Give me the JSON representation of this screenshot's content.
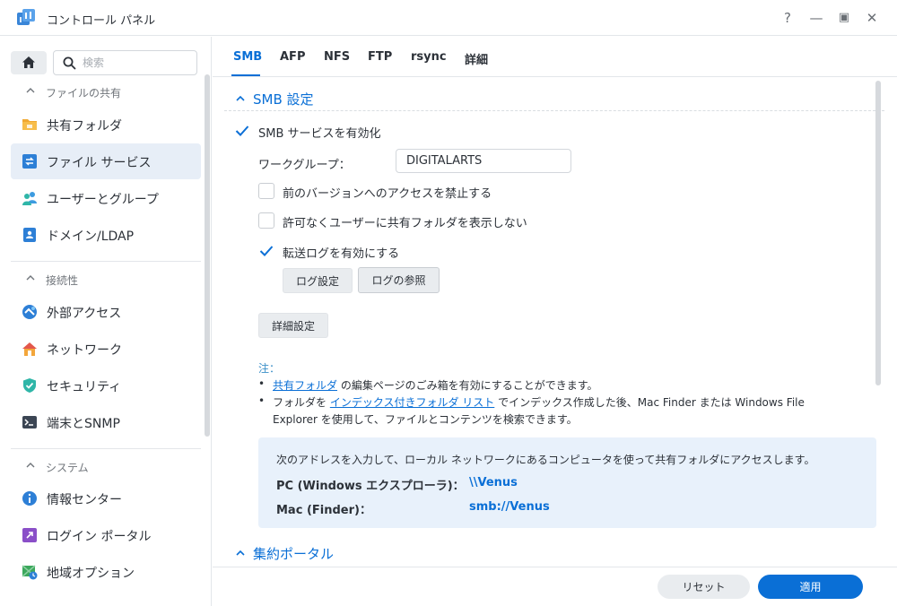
{
  "window": {
    "title": "コントロール パネル",
    "help_label": "?",
    "minimize_label": "—",
    "maximize_label": "▣",
    "close_label": "✕"
  },
  "sidebar": {
    "search_placeholder": "検索",
    "groups": [
      {
        "label": "ファイルの共有",
        "items": [
          {
            "label": "共有フォルダ",
            "icon": "folder-icon"
          },
          {
            "label": "ファイル サービス",
            "icon": "file-services-icon",
            "active": true
          },
          {
            "label": "ユーザーとグループ",
            "icon": "users-icon"
          },
          {
            "label": "ドメイン/LDAP",
            "icon": "domain-icon"
          }
        ]
      },
      {
        "label": "接続性",
        "items": [
          {
            "label": "外部アクセス",
            "icon": "external-access-icon"
          },
          {
            "label": "ネットワーク",
            "icon": "network-icon"
          },
          {
            "label": "セキュリティ",
            "icon": "security-shield-icon"
          },
          {
            "label": "端末とSNMP",
            "icon": "terminal-icon"
          }
        ]
      },
      {
        "label": "システム",
        "items": [
          {
            "label": "情報センター",
            "icon": "info-icon"
          },
          {
            "label": "ログイン ポータル",
            "icon": "login-portal-icon"
          },
          {
            "label": "地域オプション",
            "icon": "regional-options-icon"
          }
        ]
      }
    ]
  },
  "tabs": [
    {
      "label": "SMB",
      "active": true
    },
    {
      "label": "AFP"
    },
    {
      "label": "NFS"
    },
    {
      "label": "FTP"
    },
    {
      "label": "rsync"
    },
    {
      "label": "詳細"
    }
  ],
  "smb": {
    "section_title": "SMB 設定",
    "enable_label": "SMB サービスを有効化",
    "enable_checked": true,
    "workgroup_label": "ワークグループ：",
    "workgroup_value": "DIGITALARTS",
    "disable_prev_versions_label": "前のバージョンへのアクセスを禁止する",
    "disable_prev_versions_checked": false,
    "hide_unauthorized_label": "許可なくユーザーに共有フォルダを表示しない",
    "hide_unauthorized_checked": false,
    "transfer_log_label": "転送ログを有効にする",
    "transfer_log_checked": true,
    "log_settings_button": "ログ設定",
    "view_logs_button": "ログの参照",
    "advanced_button": "詳細設定"
  },
  "notes": {
    "heading": "注：",
    "line1_link": "共有フォルダ",
    "line1_rest": " の編集ページのごみ箱を有効にすることができます。",
    "line2_prefix": "フォルダを ",
    "line2_link": "インデックス付きフォルダ リスト",
    "line2_rest": " でインデックス作成した後、Mac Finder または Windows File",
    "line2_cont": "Explorer を使用して、ファイルとコンテンツを検索できます。",
    "bullet": "•"
  },
  "access_info": {
    "text": "次のアドレスを入力して、ローカル ネットワークにあるコンピュータを使って共有フォルダにアクセスします。",
    "pc_label": "PC (Windows エクスプローラ)：",
    "pc_value": "\\\\Venus",
    "mac_label": "Mac (Finder)：",
    "mac_value": "smb://Venus"
  },
  "portal": {
    "section_title": "集約ポータル"
  },
  "footer": {
    "reset_label": "リセット",
    "apply_label": "適用"
  },
  "colors": {
    "accent": "#0a6fd6",
    "active_nav_bg": "#e7eef7",
    "info_box_bg": "#e8f1fb"
  }
}
